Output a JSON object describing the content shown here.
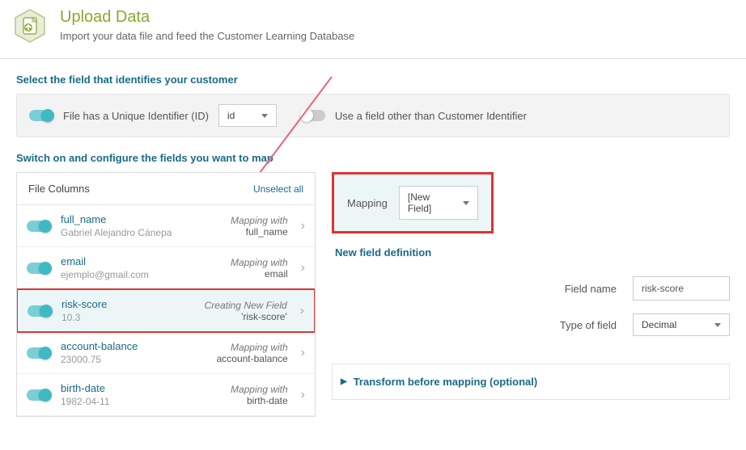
{
  "header": {
    "title": "Upload Data",
    "subtitle": "Import your data file and feed the Customer Learning Database"
  },
  "section1_label": "Select the field that identifies your customer",
  "identifier": {
    "unique_enabled": true,
    "unique_label": "File has a Unique Identifier (ID)",
    "unique_select_value": "id",
    "other_enabled": false,
    "other_label": "Use a field other than Customer Identifier"
  },
  "section2_label": "Switch on and configure the fields you want to map",
  "columns_panel": {
    "title": "File Columns",
    "unselect_label": "Unselect all"
  },
  "columns": [
    {
      "name": "full_name",
      "sample": "Gabriel Alejandro Cánepa",
      "map_label": "Mapping with",
      "map_value": "full_name",
      "on": true,
      "selected": false
    },
    {
      "name": "email",
      "sample": "ejemplo@gmail.com",
      "map_label": "Mapping with",
      "map_value": "email",
      "on": true,
      "selected": false
    },
    {
      "name": "risk-score",
      "sample": "10.3",
      "map_label": "Creating New Field",
      "map_value": "'risk-score'",
      "on": true,
      "selected": true
    },
    {
      "name": "account-balance",
      "sample": "23000.75",
      "map_label": "Mapping with",
      "map_value": "account-balance",
      "on": true,
      "selected": false
    },
    {
      "name": "birth-date",
      "sample": "1982-04-11",
      "map_label": "Mapping with",
      "map_value": "birth-date",
      "on": true,
      "selected": false
    }
  ],
  "mapping": {
    "label": "Mapping",
    "select_value": "[New Field]"
  },
  "definition": {
    "header": "New field definition",
    "field_name_label": "Field name",
    "field_name_value": "risk-score",
    "type_label": "Type of field",
    "type_value": "Decimal"
  },
  "transform_label": "Transform before mapping (optional)"
}
